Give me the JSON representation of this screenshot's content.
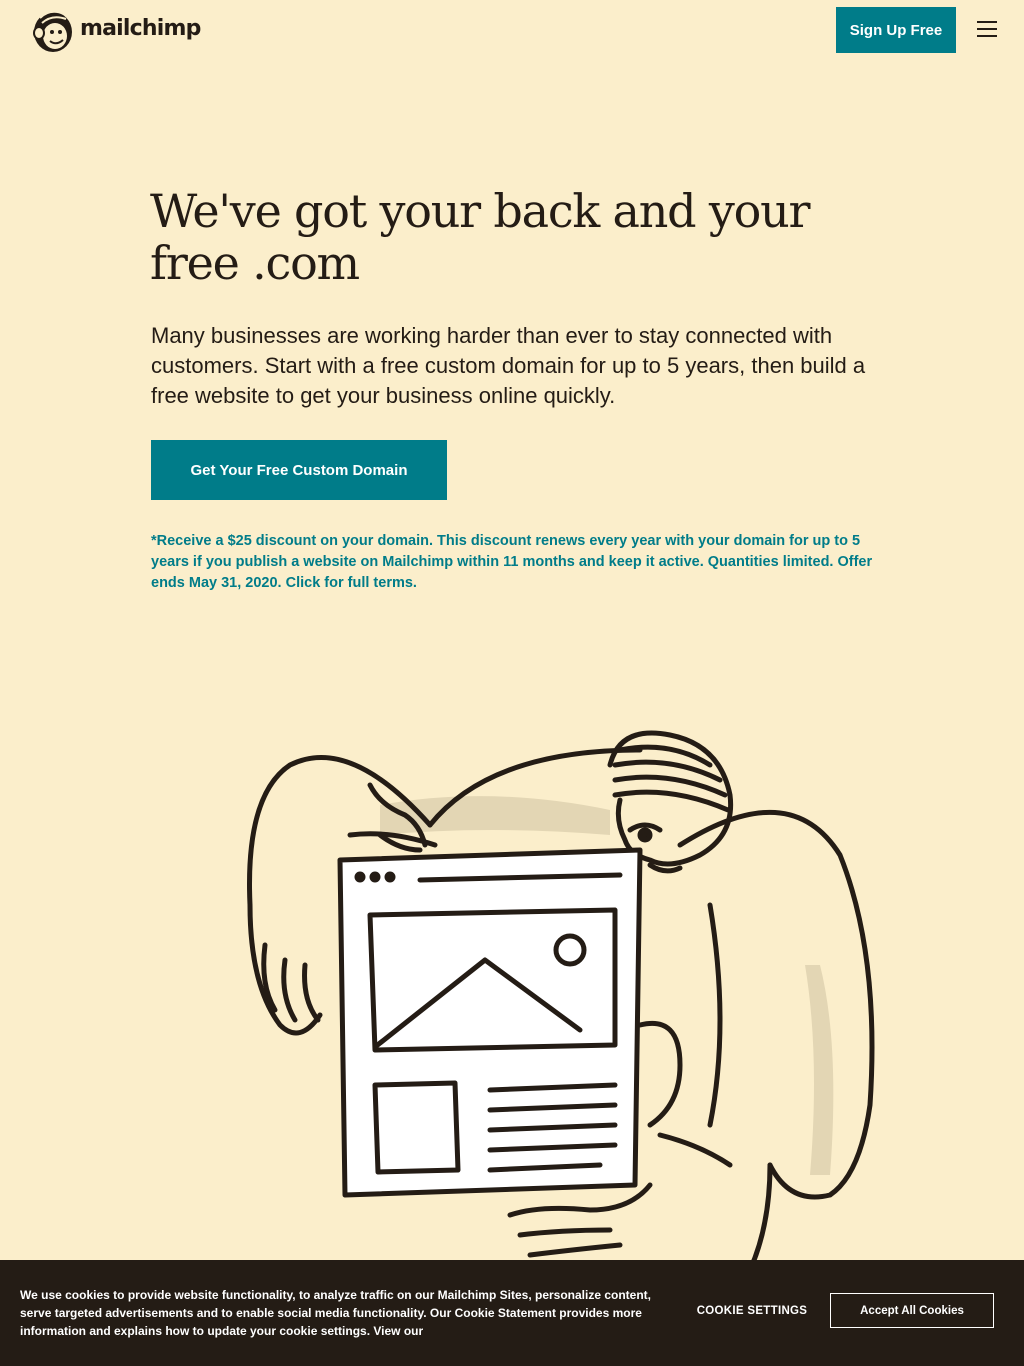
{
  "header": {
    "logo_text": "mailchimp",
    "signup_label": "Sign Up Free",
    "menu_icon": "hamburger-menu-icon"
  },
  "hero": {
    "title": "We've got your back and your free .com",
    "body": "Many businesses are working harder than ever to stay connected with customers. Start with a free custom domain for up to 5 years, then build a free website to get your business online quickly.",
    "cta_label": "Get Your Free Custom Domain",
    "disclaimer": "*Receive a $25 discount on your domain. This discount renews every year with your domain for up to 5 years if you publish a website on Mailchimp within 11 months and keep it active. Quantities limited. Offer ends May 31, 2020. Click for full terms."
  },
  "cookie_banner": {
    "text": "We use cookies to provide website functionality, to analyze traffic on our Mailchimp Sites, personalize content, serve targeted advertisements and to enable social media functionality. Our Cookie Statement provides more information and explains how to update your cookie settings. View our",
    "settings_label": "COOKIE SETTINGS",
    "accept_label": "Accept All Cookies"
  },
  "colors": {
    "background": "#fbeecb",
    "brand_teal": "#007c89",
    "ink": "#241c15",
    "cookie_bar": "#241c15"
  }
}
